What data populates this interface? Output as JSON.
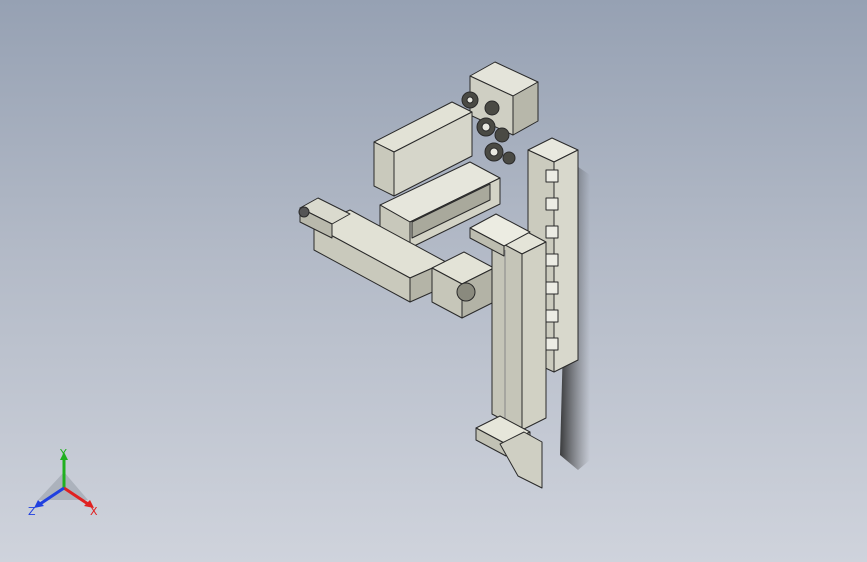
{
  "viewport": {
    "background_top": "#96a1b3",
    "background_bottom": "#cfd3dc",
    "model_color": "#d8d8cc",
    "model_edge_color": "#2a2a2a",
    "shadow_color": "#333333"
  },
  "triad": {
    "x_label": "X",
    "y_label": "Y",
    "z_label": "Z",
    "x_color": "#e02020",
    "y_color": "#20b020",
    "z_color": "#2040e0"
  }
}
